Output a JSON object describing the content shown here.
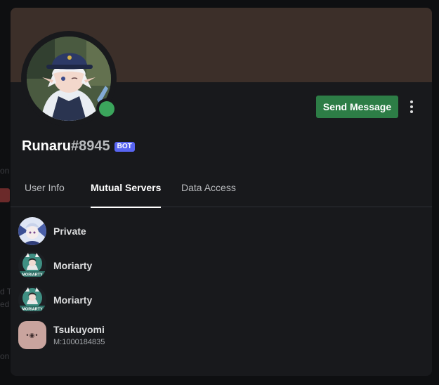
{
  "colors": {
    "banner": "#3c2f29",
    "modal_bg": "#18191c",
    "status_online": "#3ba55c",
    "send_button": "#2d7d46",
    "bot_badge": "#5865f2",
    "tsukuyomi_icon_bg": "#c9a49e"
  },
  "profile": {
    "username": "Runaru",
    "discriminator": "#8945",
    "badge": "BOT",
    "status": "online"
  },
  "actions": {
    "send_message_label": "Send Message",
    "more_icon": "more-vertical-icon"
  },
  "tabs": [
    {
      "label": "User Info",
      "active": false
    },
    {
      "label": "Mutual Servers",
      "active": true
    },
    {
      "label": "Data Access",
      "active": false
    }
  ],
  "mutual_servers": [
    {
      "name": "Private",
      "nickname": ""
    },
    {
      "name": "Moriarty",
      "nickname": ""
    },
    {
      "name": "Moriarty",
      "nickname": ""
    },
    {
      "name": "Tsukuyomi",
      "nickname": "M:1000184835"
    }
  ],
  "icons": {
    "moriarty_caption": "MORIARTY",
    "tsukuyomi_glyph": "•◉•"
  }
}
